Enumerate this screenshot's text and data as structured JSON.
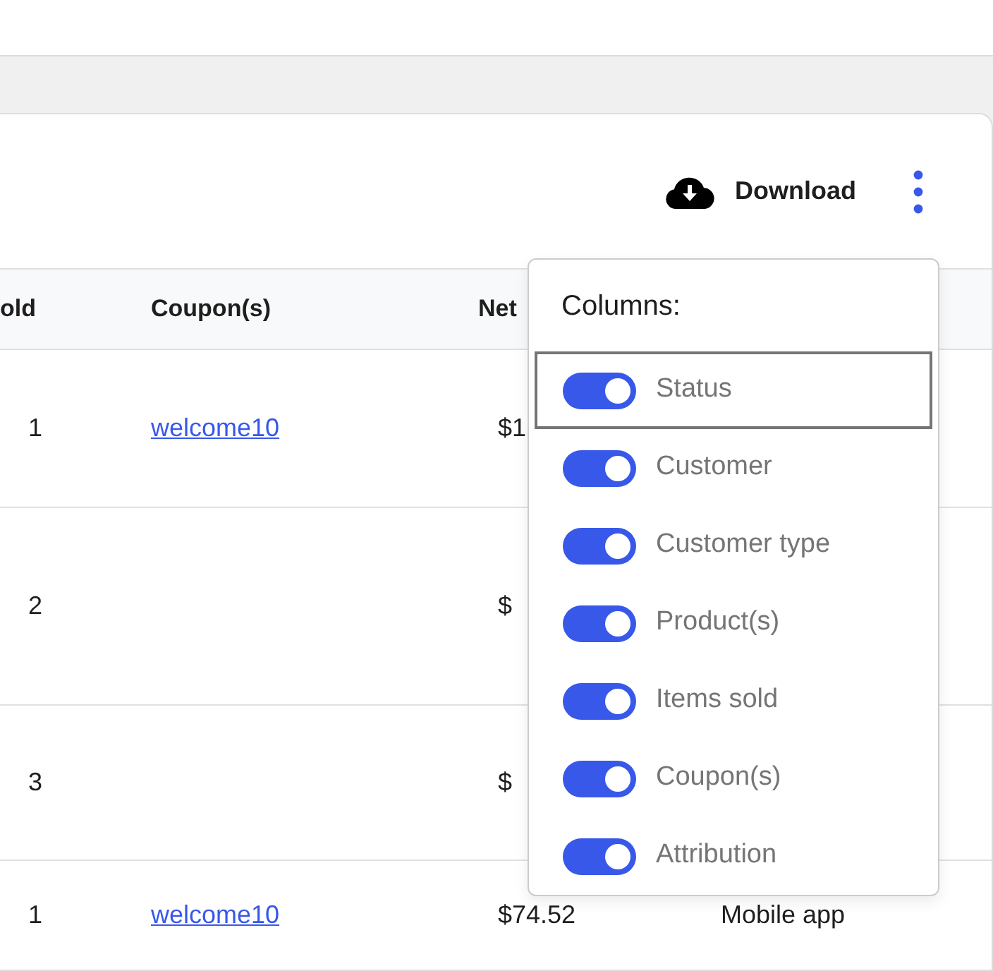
{
  "toolbar": {
    "download_label": "Download"
  },
  "table": {
    "columns": [
      "old",
      "Coupon(s)",
      "Net"
    ],
    "rows": [
      {
        "cells": [
          "1",
          "welcome10",
          "$1"
        ]
      },
      {
        "cells": [
          "2",
          "",
          "$"
        ]
      },
      {
        "cells": [
          "3",
          "",
          "$"
        ]
      },
      {
        "cells": [
          "1",
          "welcome10",
          "$74.52",
          "Mobile app"
        ]
      }
    ]
  },
  "columns_menu": {
    "title": "Columns:",
    "items": [
      {
        "label": "Status",
        "on": true,
        "focused": true
      },
      {
        "label": "Customer",
        "on": true,
        "focused": false
      },
      {
        "label": "Customer type",
        "on": true,
        "focused": false
      },
      {
        "label": "Product(s)",
        "on": true,
        "focused": false
      },
      {
        "label": "Items sold",
        "on": true,
        "focused": false
      },
      {
        "label": "Coupon(s)",
        "on": true,
        "focused": false
      },
      {
        "label": "Attribution",
        "on": true,
        "focused": false
      }
    ]
  }
}
